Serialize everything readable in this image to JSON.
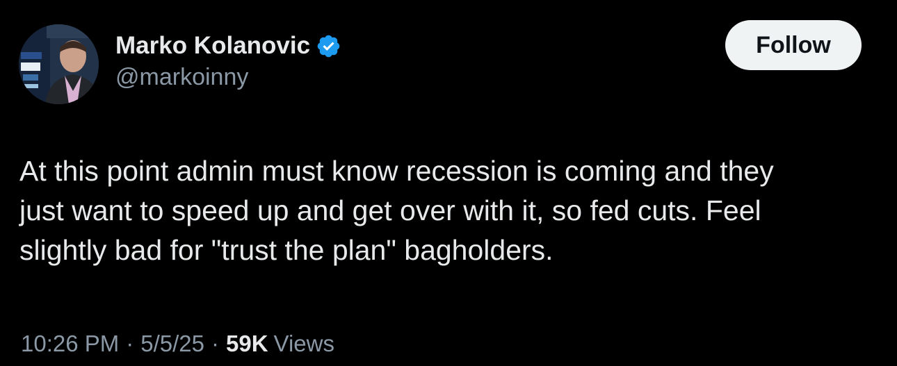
{
  "tweet": {
    "author": {
      "display_name": "Marko Kolanovic",
      "handle": "@markoinny",
      "verified": true,
      "avatar_icon": "profile-photo-icon"
    },
    "follow_label": "Follow",
    "text": "At this point admin must know recession is coming and they\njust want to speed up and get over with it, so fed cuts. Feel\nslightly bad for \"trust the plan\" bagholders.",
    "meta": {
      "time": "10:26 PM",
      "separator": "·",
      "date": "5/5/25",
      "views_count": "59K",
      "views_label": "Views"
    }
  },
  "colors": {
    "background": "#000000",
    "primary_text": "#e7e9ea",
    "secondary_text": "#8b98a5",
    "verified_badge": "#1d9bf0",
    "follow_button_bg": "#eff3f4",
    "follow_button_text": "#0f1419"
  }
}
